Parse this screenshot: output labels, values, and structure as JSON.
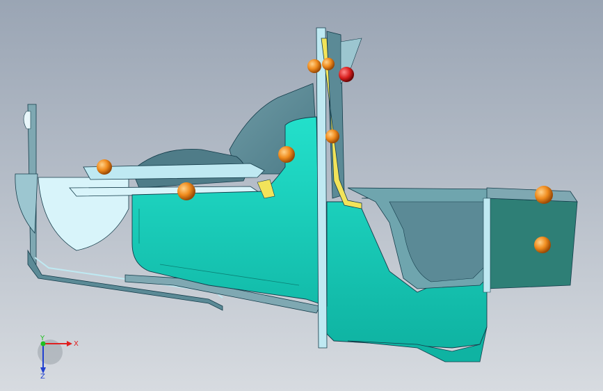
{
  "viewport": {
    "colors": {
      "bg_top": "#9aa5b4",
      "bg_bottom": "#d7dbe0",
      "part_teal": "#17d3be",
      "part_teal_dark": "#0fa596",
      "part_teal_deep": "#2e7f76",
      "part_slate": "#5b8a96",
      "part_slate_light": "#7fa8b2",
      "flange_light": "#bfe9f2",
      "flange_pale": "#d8f4fa",
      "edge": "#143c4a",
      "yellow": "#f2e35a",
      "weld_orange": "#f08c1e",
      "weld_red": "#d81e1e"
    }
  },
  "triad": {
    "x_label": "X",
    "y_label": "Y",
    "z_label": "Z",
    "colors": {
      "x": "#e02020",
      "y": "#20c020",
      "z": "#2040d0"
    }
  }
}
